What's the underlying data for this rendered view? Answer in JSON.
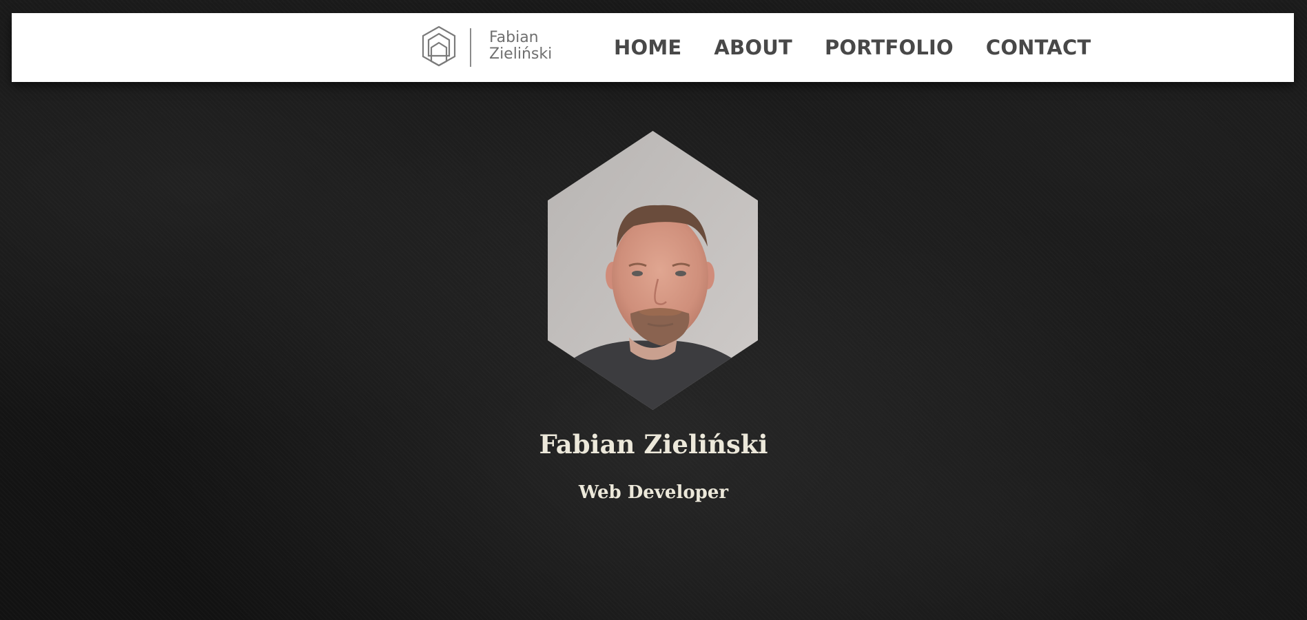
{
  "brand": {
    "first_name": "Fabian",
    "last_name": "Zieliński",
    "logo_icon": "hexagon-house-logo-icon"
  },
  "nav": {
    "items": [
      {
        "label": "HOME"
      },
      {
        "label": "ABOUT"
      },
      {
        "label": "PORTFOLIO"
      },
      {
        "label": "CONTACT"
      }
    ]
  },
  "hero": {
    "name": "Fabian Zieliński",
    "role": "Web Developer",
    "photo": "profile-photo"
  },
  "colors": {
    "background": "#161616",
    "navbar": "#ffffff",
    "nav_text": "#484848",
    "logo_text": "#6f6f6f",
    "hero_text": "#ece8da"
  }
}
